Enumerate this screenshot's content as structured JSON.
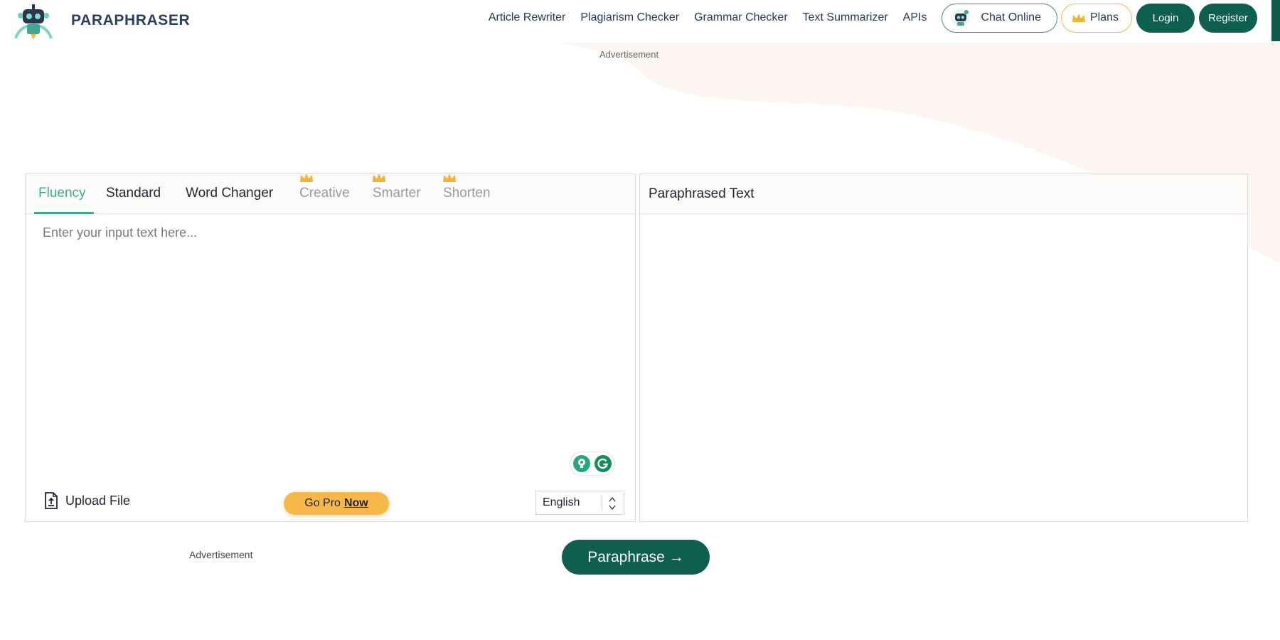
{
  "brand": {
    "name": "PARAPHRASER"
  },
  "nav": {
    "links": [
      "Article Rewriter",
      "Plagiarism Checker",
      "Grammar Checker",
      "Text Summarizer",
      "APIs"
    ],
    "chat_label": "Chat Online",
    "plans_label": "Plans",
    "login_label": "Login",
    "register_label": "Register"
  },
  "ads": {
    "top_label": "Advertisement",
    "bottom_label": "Advertisement"
  },
  "editor": {
    "tabs": [
      {
        "label": "Fluency",
        "state": "active"
      },
      {
        "label": "Standard",
        "state": "normal"
      },
      {
        "label": "Word Changer",
        "state": "normal"
      },
      {
        "label": "Creative",
        "state": "locked"
      },
      {
        "label": "Smarter",
        "state": "locked"
      },
      {
        "label": "Shorten",
        "state": "locked"
      }
    ],
    "input_placeholder": "Enter your input text here...",
    "input_value": "",
    "upload_label": "Upload File",
    "gopro_label": "Go Pro",
    "gopro_emphasis": "Now",
    "language_selected": "English"
  },
  "output": {
    "header_label": "Paraphrased Text"
  },
  "actions": {
    "paraphrase_label": "Paraphrase →"
  },
  "colors": {
    "brand_green": "#0e5f50",
    "accent_teal": "#3fa88e",
    "gold": "#f7b84b",
    "nav_text": "#2a3550",
    "background_blob": "#fdf5f1"
  }
}
